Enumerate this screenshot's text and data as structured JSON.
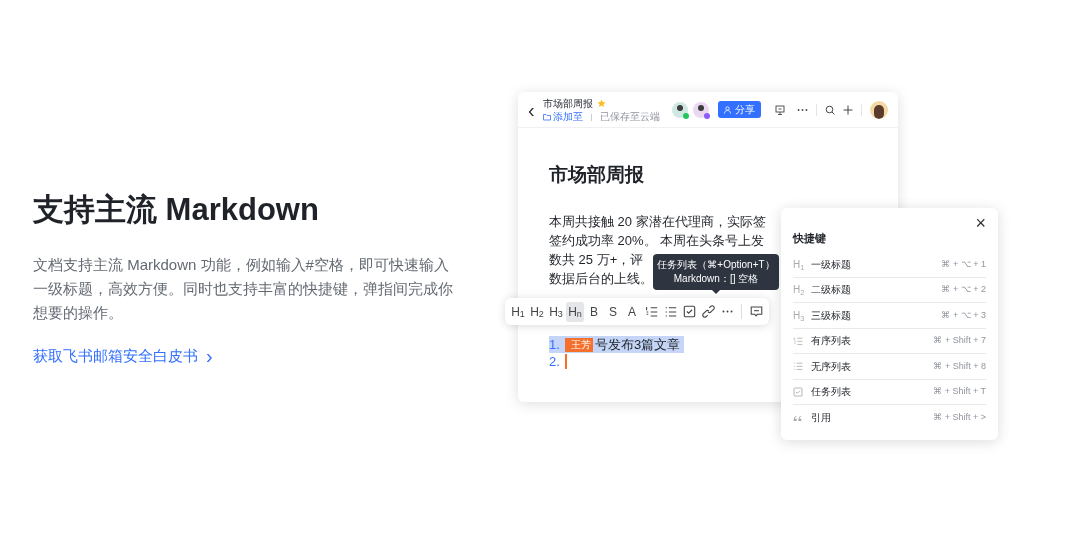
{
  "hero": {
    "title": "支持主流 Markdown",
    "description": "文档支持主流 Markdown 功能，例如输入#空格，即可快速输入一级标题，高效方便。同时也支持丰富的快捷键，弹指间完成你想要的操作。",
    "link": "获取飞书邮箱安全白皮书",
    "link_arrow": "›"
  },
  "doc": {
    "back": "‹",
    "title": "市场部周报",
    "starred": true,
    "folder": "添加至",
    "save_status": "已保存至云端",
    "collaborators": [
      {
        "color": "#22c55e"
      },
      {
        "color": "#8b5cf6"
      }
    ],
    "share_button": "分享",
    "heading": "市场部周报",
    "body_lines": [
      [
        "本周共接触 20 家潜在代理商，实际签"
      ],
      [
        "签约成功率 20%。 本周在头条号上发"
      ],
      [
        "数共 25 万+，评"
      ],
      [
        "数据后台的上线。"
      ]
    ],
    "list_items": [
      {
        "number": "1.",
        "text": "号发布3篇文章",
        "selected": true,
        "tag": "王芳"
      },
      {
        "number": "2.",
        "selected": false
      }
    ]
  },
  "toolbar": [
    {
      "kind": "text",
      "label": "H$_{1}$",
      "selected": false
    },
    {
      "kind": "text",
      "label": "H$_{2}$",
      "selected": false
    },
    {
      "kind": "text",
      "label": "H$_{3}$",
      "selected": false
    },
    {
      "kind": "text",
      "label": "H$_{n}$",
      "selected": true
    },
    {
      "kind": "text",
      "label": "B",
      "selected": false
    },
    {
      "kind": "text",
      "label": "S",
      "selected": false
    },
    {
      "kind": "text",
      "label": "A",
      "selected": false
    },
    {
      "kind": "ordered",
      "selected": false
    },
    {
      "kind": "bullet",
      "selected": false
    },
    {
      "kind": "task",
      "selected": false
    },
    {
      "kind": "link",
      "selected": false
    },
    {
      "kind": "more",
      "selected": false
    },
    {
      "kind": "divider"
    },
    {
      "kind": "comment",
      "selected": false
    }
  ],
  "tooltip": {
    "title": "任务列表（⌘+Option+T）",
    "hint": "Markdown：[] 空格"
  },
  "shortcuts": {
    "title": "快捷键",
    "close": "×",
    "rows": [
      {
        "kind": "text",
        "icon_text": "H$_{1}$",
        "label": "一级标题",
        "keys": "⌘ + ⌥ + 1"
      },
      {
        "kind": "text",
        "icon_text": "H$_{2}$",
        "label": "二级标题",
        "keys": "⌘ + ⌥ + 2"
      },
      {
        "kind": "text",
        "icon_text": "H$_{3}$",
        "label": "三级标题",
        "keys": "⌘ + ⌥ + 3"
      },
      {
        "kind": "ordered",
        "label": "有序列表",
        "keys": "⌘ + Shift + 7"
      },
      {
        "kind": "bullet",
        "label": "无序列表",
        "keys": "⌘ + Shift + 8"
      },
      {
        "kind": "task",
        "label": "任务列表",
        "keys": "⌘ + Shift + T"
      },
      {
        "kind": "quote",
        "label": "引用",
        "keys": "⌘ + Shift + >"
      }
    ]
  }
}
